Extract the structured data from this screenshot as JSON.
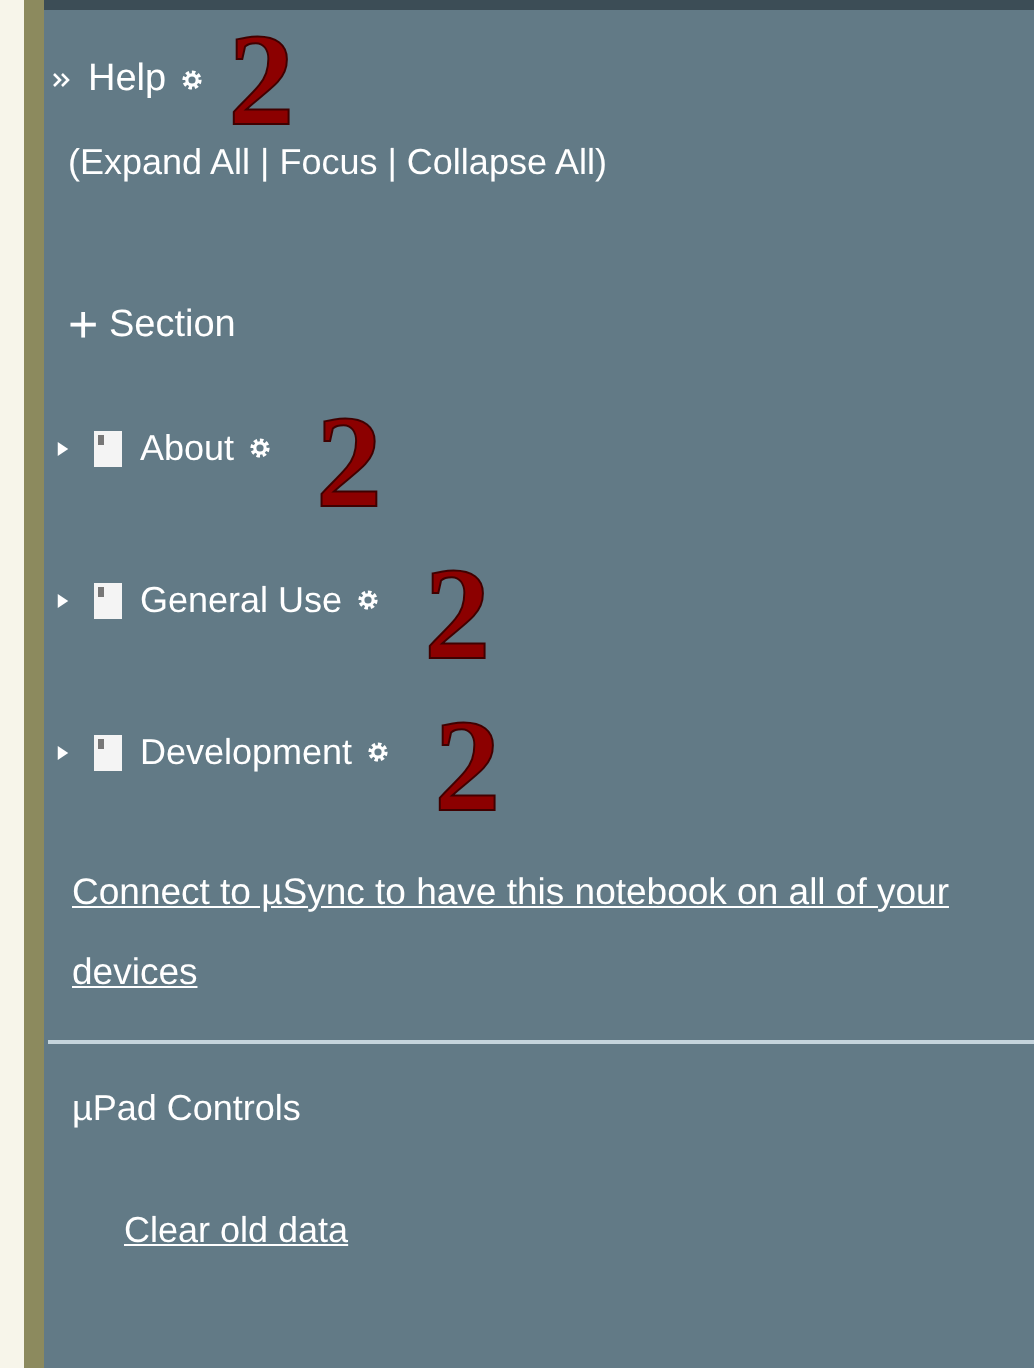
{
  "notebook": {
    "title": "Help",
    "annotation": "2",
    "actions": "(Expand All | Focus | Collapse All)"
  },
  "add_section": {
    "icon": "+",
    "label": "Section"
  },
  "sections": [
    {
      "label": "About",
      "expanded": false,
      "annotation": "2"
    },
    {
      "label": "General Use",
      "expanded": false,
      "annotation": "2"
    },
    {
      "label": "Development",
      "expanded": false,
      "annotation": "2"
    }
  ],
  "sync_link": "Connect to µSync to have this notebook on all of your devices",
  "controls": {
    "heading": "µPad Controls",
    "links": [
      "Clear old data"
    ]
  }
}
